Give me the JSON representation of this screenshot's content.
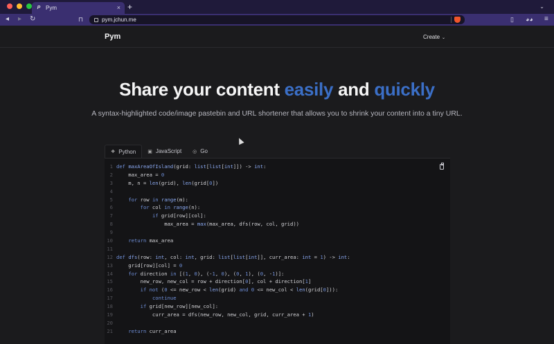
{
  "browser": {
    "tab_title": "Pym",
    "tab_favicon": "P",
    "url": "pym.jchun.me",
    "colors": {
      "tabbar": "#1f1a3a",
      "toolbar": "#3a2f70",
      "brave": "#f0552b"
    }
  },
  "nav": {
    "brand": "Pym",
    "create_label": "Create"
  },
  "hero": {
    "title_start": "Share your content",
    "title_easily": "easily",
    "title_and": "and",
    "title_quickly": "quickly",
    "subtitle": "A syntax-highlighted code/image pastebin and URL shortener that allows you to shrink your content into a tiny URL.",
    "accent": "#3b6fc7"
  },
  "code_tabs": [
    {
      "label": "Python",
      "icon": "python-icon",
      "active": true
    },
    {
      "label": "JavaScript",
      "icon": "javascript-icon",
      "active": false
    },
    {
      "label": "Go",
      "icon": "go-icon",
      "active": false
    }
  ],
  "code_lines": [
    "def maxAreaOfIsland(grid: list[list[int]]) -> int:",
    "    max_area = 0",
    "    m, n = len(grid), len(grid[0])",
    "",
    "    for row in range(m):",
    "        for col in range(n):",
    "            if grid[row][col]:",
    "                max_area = max(max_area, dfs(row, col, grid))",
    "",
    "    return max_area",
    "",
    "def dfs(row: int, col: int, grid: list[list[int]], curr_area: int = 1) -> int:",
    "    grid[row][col] = 0",
    "    for direction in [(1, 0), (-1, 0), (0, 1), (0, -1)]:",
    "        new_row, new_col = row + direction[0], col + direction[1]",
    "        if not (0 <= new_row < len(grid) and 0 <= new_col < len(grid[0])):",
    "            continue",
    "        if grid[new_row][new_col]:",
    "            curr_area = dfs(new_row, new_col, grid, curr_area + 1)",
    "",
    "    return curr_area"
  ]
}
